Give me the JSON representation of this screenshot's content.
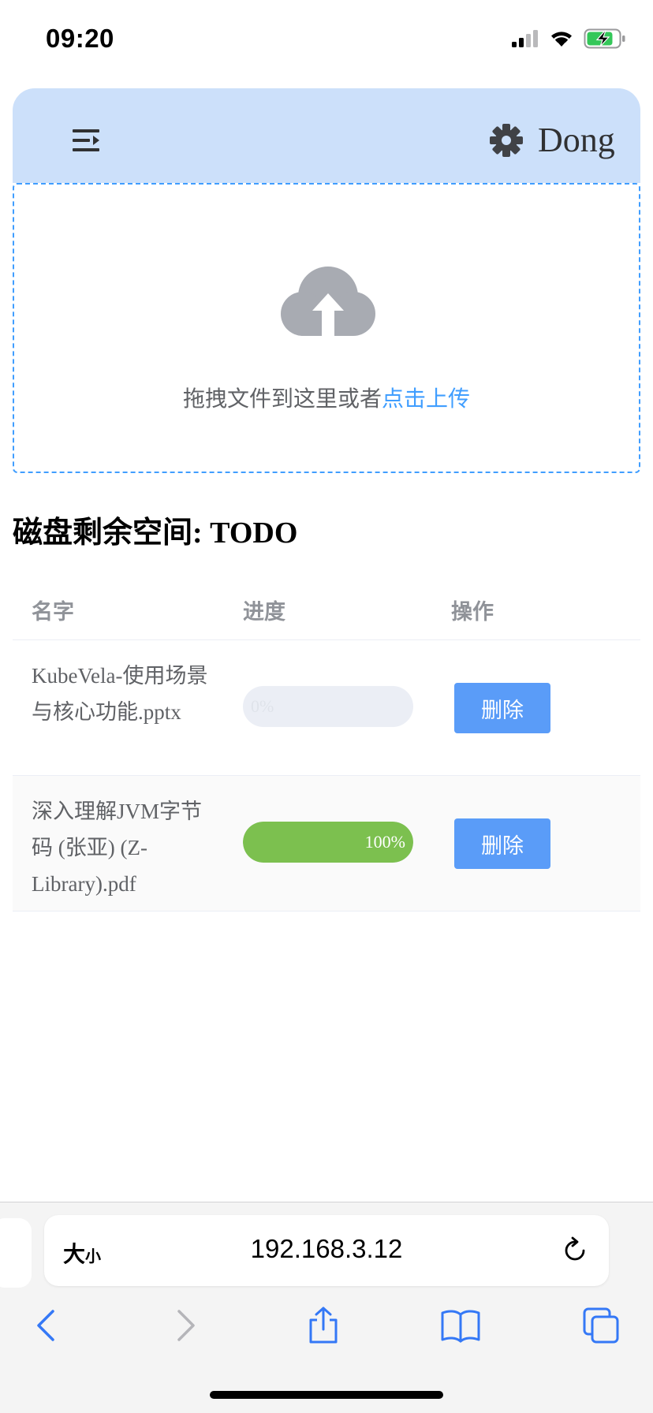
{
  "status": {
    "time": "09:20"
  },
  "header": {
    "user_name": "Dong"
  },
  "upload": {
    "prompt_text": "拖拽文件到这里或者",
    "link_text": "点击上传"
  },
  "disk": {
    "label": "磁盘剩余空间: TODO"
  },
  "table": {
    "columns": [
      "名字",
      "进度",
      "操作"
    ],
    "rows": [
      {
        "name": "KubeVela-使用场景与核心功能.pptx",
        "progress": 0,
        "progress_text": "0%",
        "action": "删除"
      },
      {
        "name": "深入理解JVM字节码 (张亚) (Z-Library).pdf",
        "progress": 100,
        "progress_text": "100%",
        "action": "删除"
      }
    ]
  },
  "browser": {
    "text_size_label": "大",
    "text_size_small": "小",
    "url": "192.168.3.12"
  },
  "colors": {
    "accent": "#409eff",
    "header_bg": "#cce0fa",
    "progress_done": "#7cc04f",
    "button_bg": "#5a9cf8"
  }
}
